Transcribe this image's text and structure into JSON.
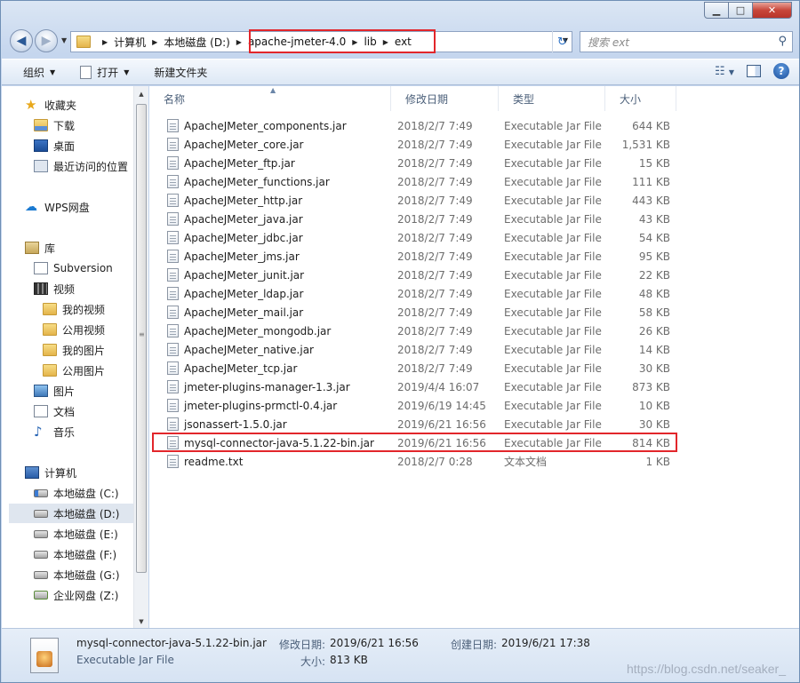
{
  "window": {
    "minimize_glyph": "▁",
    "maximize_glyph": "□",
    "close_glyph": "✕"
  },
  "navigation": {
    "back_glyph": "◀",
    "forward_glyph": "▶",
    "dropdown_glyph": "▼",
    "breadcrumb": [
      "计算机",
      "本地磁盘 (D:)",
      "apache-jmeter-4.0",
      "lib",
      "ext"
    ],
    "refresh_glyph": "↻"
  },
  "search": {
    "placeholder": "搜索 ext",
    "icon": "magnifier-icon"
  },
  "toolbar": {
    "organize_label": "组织",
    "open_label": "打开",
    "new_folder_label": "新建文件夹",
    "views_icon": "views-icon",
    "preview_pane_icon": "preview-pane-icon",
    "help_glyph": "?"
  },
  "sidebar": {
    "favorites": {
      "label": "收藏夹",
      "items": [
        "下载",
        "桌面",
        "最近访问的位置"
      ]
    },
    "wps": {
      "label": "WPS网盘"
    },
    "libraries": {
      "label": "库",
      "subversion": "Subversion",
      "videos": "视频",
      "video_children": [
        "我的视频",
        "公用视频",
        "我的图片",
        "公用图片"
      ],
      "pictures": "图片",
      "documents": "文档",
      "music": "音乐"
    },
    "computer": {
      "label": "计算机",
      "drives": [
        "本地磁盘 (C:)",
        "本地磁盘 (D:)",
        "本地磁盘 (E:)",
        "本地磁盘 (F:)",
        "本地磁盘 (G:)",
        "企业网盘 (Z:)"
      ],
      "selected_index": 1
    }
  },
  "columns": {
    "name": "名称",
    "date": "修改日期",
    "type": "类型",
    "size": "大小"
  },
  "files": [
    {
      "name": "ApacheJMeter_components.jar",
      "date": "2018/2/7 7:49",
      "type": "Executable Jar File",
      "size": "644 KB"
    },
    {
      "name": "ApacheJMeter_core.jar",
      "date": "2018/2/7 7:49",
      "type": "Executable Jar File",
      "size": "1,531 KB"
    },
    {
      "name": "ApacheJMeter_ftp.jar",
      "date": "2018/2/7 7:49",
      "type": "Executable Jar File",
      "size": "15 KB"
    },
    {
      "name": "ApacheJMeter_functions.jar",
      "date": "2018/2/7 7:49",
      "type": "Executable Jar File",
      "size": "111 KB"
    },
    {
      "name": "ApacheJMeter_http.jar",
      "date": "2018/2/7 7:49",
      "type": "Executable Jar File",
      "size": "443 KB"
    },
    {
      "name": "ApacheJMeter_java.jar",
      "date": "2018/2/7 7:49",
      "type": "Executable Jar File",
      "size": "43 KB"
    },
    {
      "name": "ApacheJMeter_jdbc.jar",
      "date": "2018/2/7 7:49",
      "type": "Executable Jar File",
      "size": "54 KB"
    },
    {
      "name": "ApacheJMeter_jms.jar",
      "date": "2018/2/7 7:49",
      "type": "Executable Jar File",
      "size": "95 KB"
    },
    {
      "name": "ApacheJMeter_junit.jar",
      "date": "2018/2/7 7:49",
      "type": "Executable Jar File",
      "size": "22 KB"
    },
    {
      "name": "ApacheJMeter_ldap.jar",
      "date": "2018/2/7 7:49",
      "type": "Executable Jar File",
      "size": "48 KB"
    },
    {
      "name": "ApacheJMeter_mail.jar",
      "date": "2018/2/7 7:49",
      "type": "Executable Jar File",
      "size": "58 KB"
    },
    {
      "name": "ApacheJMeter_mongodb.jar",
      "date": "2018/2/7 7:49",
      "type": "Executable Jar File",
      "size": "26 KB"
    },
    {
      "name": "ApacheJMeter_native.jar",
      "date": "2018/2/7 7:49",
      "type": "Executable Jar File",
      "size": "14 KB"
    },
    {
      "name": "ApacheJMeter_tcp.jar",
      "date": "2018/2/7 7:49",
      "type": "Executable Jar File",
      "size": "30 KB"
    },
    {
      "name": "jmeter-plugins-manager-1.3.jar",
      "date": "2019/4/4 16:07",
      "type": "Executable Jar File",
      "size": "873 KB"
    },
    {
      "name": "jmeter-plugins-prmctl-0.4.jar",
      "date": "2019/6/19 14:45",
      "type": "Executable Jar File",
      "size": "10 KB"
    },
    {
      "name": "jsonassert-1.5.0.jar",
      "date": "2019/6/21 16:56",
      "type": "Executable Jar File",
      "size": "30 KB"
    },
    {
      "name": "mysql-connector-java-5.1.22-bin.jar",
      "date": "2019/6/21 16:56",
      "type": "Executable Jar File",
      "size": "814 KB"
    },
    {
      "name": "readme.txt",
      "date": "2018/2/7 0:28",
      "type": "文本文档",
      "size": "1 KB"
    }
  ],
  "highlighted_file_index": 17,
  "details": {
    "name": "mysql-connector-java-5.1.22-bin.jar",
    "type": "Executable Jar File",
    "modified_label": "修改日期:",
    "modified_value": "2019/6/21 16:56",
    "created_label": "创建日期:",
    "created_value": "2019/6/21 17:38",
    "size_label": "大小:",
    "size_value": "813 KB"
  },
  "watermark": "https://blog.csdn.net/seaker_",
  "colors": {
    "highlight_border": "#e2262b",
    "selection_bg": "#dfe6ef"
  }
}
